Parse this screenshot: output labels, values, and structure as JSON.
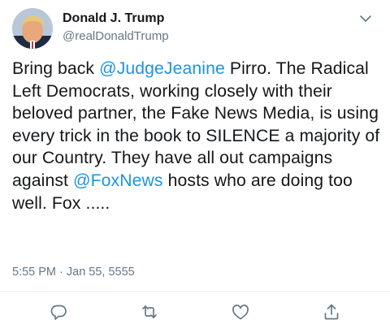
{
  "author": {
    "display_name": "Donald J. Trump",
    "handle": "@realDonaldTrump"
  },
  "tweet": {
    "segments": [
      {
        "text": "Bring back ",
        "type": "text"
      },
      {
        "text": "@JudgeJeanine",
        "type": "mention"
      },
      {
        "text": " Pirro. The Radical Left Democrats, working closely with their beloved partner, the Fake News Media, is using every trick in the book to SILENCE a majority of our Country. They have all out campaigns against ",
        "type": "text"
      },
      {
        "text": "@FoxNews",
        "type": "mention"
      },
      {
        "text": " hosts who are doing too well. Fox .....",
        "type": "text"
      }
    ],
    "timestamp": "5:55 PM · Jan 55, 5555"
  },
  "actions": [
    {
      "name": "reply",
      "icon": "reply-icon"
    },
    {
      "name": "retweet",
      "icon": "retweet-icon"
    },
    {
      "name": "like",
      "icon": "like-icon"
    },
    {
      "name": "share",
      "icon": "share-icon"
    }
  ],
  "colors": {
    "text": "#14171a",
    "secondary": "#657786",
    "link": "#1b95e0",
    "divider": "#e6ecf0"
  }
}
